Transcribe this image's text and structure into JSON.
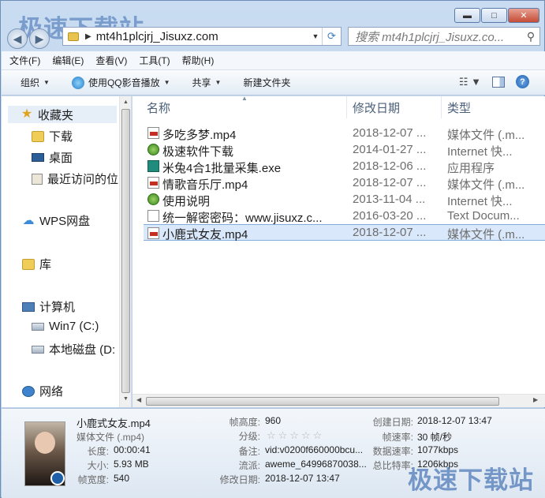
{
  "watermark": "极速下载站",
  "window_buttons": {
    "minimize": "▬",
    "maximize": "□",
    "close": "✕"
  },
  "address": {
    "path": "mt4h1plcjrj_Jisuxz.com"
  },
  "search": {
    "placeholder": "搜索 mt4h1plcjrj_Jisuxz.co..."
  },
  "menu": [
    "文件(F)",
    "编辑(E)",
    "查看(V)",
    "工具(T)",
    "帮助(H)"
  ],
  "toolbar": {
    "organize": "组织",
    "qq_play": "使用QQ影音播放",
    "share": "共享",
    "new_folder": "新建文件夹"
  },
  "nav": {
    "favorites": "收藏夹",
    "downloads": "下载",
    "desktop": "桌面",
    "recent": "最近访问的位",
    "wps": "WPS网盘",
    "library": "库",
    "computer": "计算机",
    "win7": "Win7 (C:)",
    "local_disk": "本地磁盘 (D:",
    "network": "网络"
  },
  "columns": {
    "name": "名称",
    "date": "修改日期",
    "type": "类型"
  },
  "files": [
    {
      "name": "多吃多梦.mp4",
      "date": "2018-12-07 ...",
      "type": "媒体文件 (.m..."
    },
    {
      "name": "极速软件下载",
      "date": "2014-01-27 ...",
      "type": "Internet 快..."
    },
    {
      "name": "米兔4合1批量采集.exe",
      "date": "2018-12-06 ...",
      "type": "应用程序"
    },
    {
      "name": "情歌音乐厅.mp4",
      "date": "2018-12-07 ...",
      "type": "媒体文件 (.m..."
    },
    {
      "name": "使用说明",
      "date": "2013-11-04 ...",
      "type": "Internet 快..."
    },
    {
      "name": "统一解密密码：www.jisuxz.c...",
      "date": "2016-03-20 ...",
      "type": "Text Docum..."
    },
    {
      "name": "小鹿式女友.mp4",
      "date": "2018-12-07 ...",
      "type": "媒体文件 (.m..."
    }
  ],
  "details": {
    "title": "小鹿式女友.mp4",
    "subtitle": "媒体文件 (.mp4)",
    "length_label": "长度:",
    "length": "00:00:41",
    "size_label": "大小:",
    "size": "5.93 MB",
    "width_label": "帧宽度:",
    "width": "540",
    "height_label": "帧高度:",
    "height": "960",
    "rating_label": "分级:",
    "rating": 0,
    "comment_label": "备注:",
    "comment": "vid:v0200f660000bcu...",
    "genre_label": "流派:",
    "genre": "aweme_64996870038...",
    "modified_label": "修改日期:",
    "modified": "2018-12-07 13:47",
    "created_label": "创建日期:",
    "created": "2018-12-07 13:47",
    "framerate_label": "帧速率:",
    "framerate": "30 帧/秒",
    "datarate_label": "数据速率:",
    "datarate": "1077kbps",
    "bitrate_label": "总比特率:",
    "bitrate": "1206kbps"
  }
}
